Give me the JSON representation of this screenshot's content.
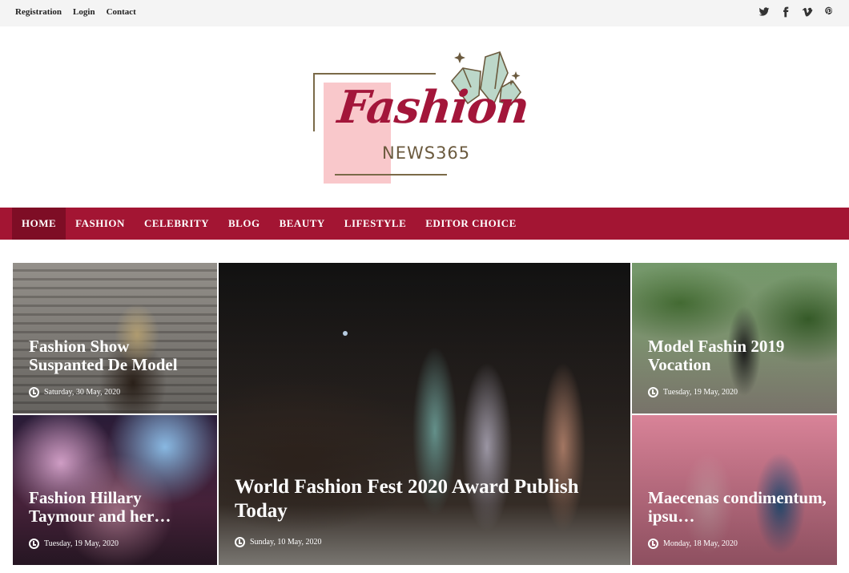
{
  "topbar": {
    "links": [
      "Registration",
      "Login",
      "Contact"
    ],
    "social_icons": [
      "twitter-icon",
      "facebook-icon",
      "vimeo-icon",
      "pinterest-icon"
    ]
  },
  "logo": {
    "script_text": "Fashion",
    "sub_text": "NEWS365"
  },
  "nav": {
    "items": [
      "HOME",
      "FASHION",
      "CELEBRITY",
      "BLOG",
      "BEAUTY",
      "LIFESTYLE",
      "EDITOR CHOICE"
    ],
    "active": "HOME"
  },
  "posts": [
    {
      "title": "Fashion Show Suspanted De Model",
      "date": "Saturday, 30 May, 2020"
    },
    {
      "title": "Fashion Hillary Taymour and her…",
      "date": "Tuesday, 19 May, 2020"
    },
    {
      "title": "World Fashion Fest 2020 Award Publish Today",
      "date": "Sunday, 10 May, 2020"
    },
    {
      "title": "Model Fashin 2019 Vocation",
      "date": "Tuesday, 19 May, 2020"
    },
    {
      "title": "Maecenas condimentum, ipsu…",
      "date": "Monday, 18 May, 2020"
    }
  ],
  "colors": {
    "brand": "#a31533",
    "brand_active": "#7e0d25",
    "topbar_bg": "#f4f4f4"
  }
}
